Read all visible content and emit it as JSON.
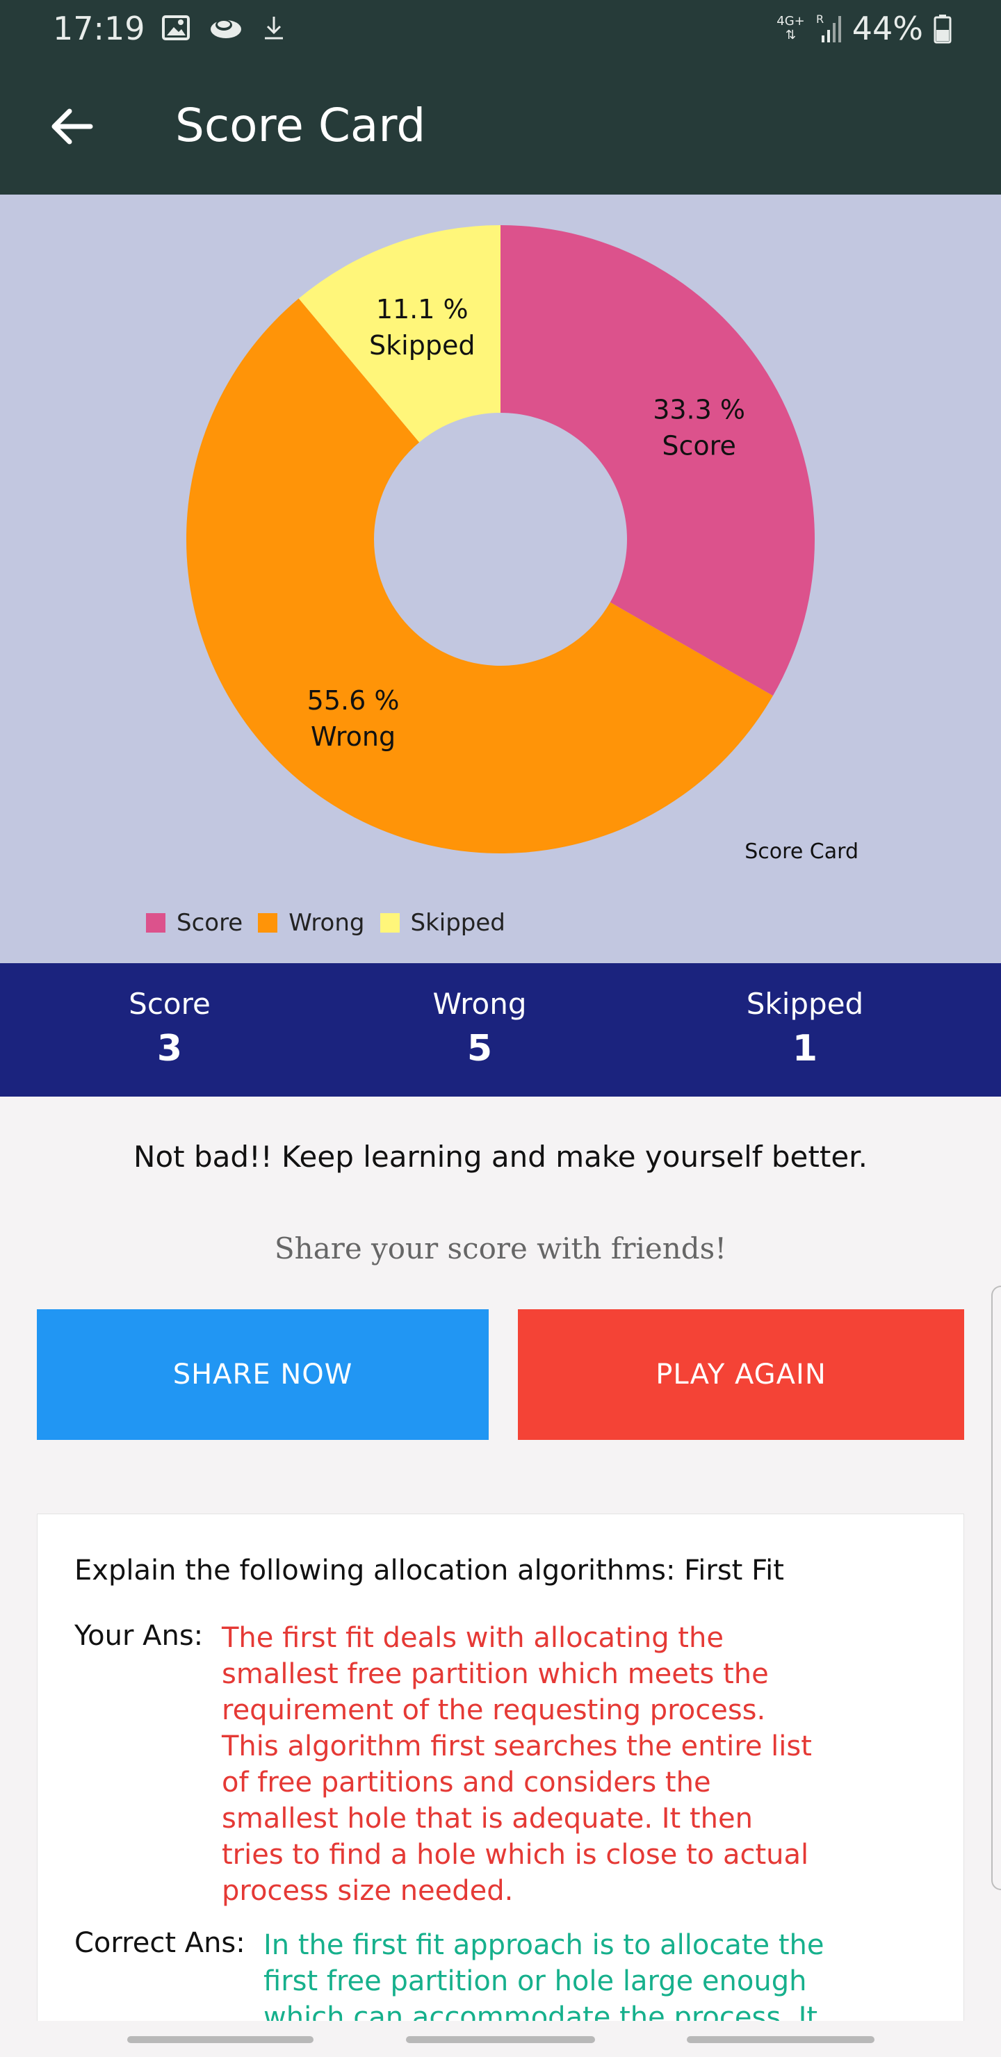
{
  "status_bar": {
    "time": "17:19",
    "network": "4G+",
    "roaming": "R",
    "battery": "44%",
    "icons": [
      "image-icon",
      "cloud-icon",
      "download-icon",
      "signal-icon",
      "battery-icon"
    ]
  },
  "app_bar": {
    "title": "Score Card",
    "back_icon": "arrow-left-icon"
  },
  "chart_data": {
    "type": "pie",
    "donut": true,
    "description": "Score Card",
    "slices": [
      {
        "label": "Score",
        "value": 33.3,
        "display": "33.3 %",
        "color": "#dc528c"
      },
      {
        "label": "Wrong",
        "value": 55.6,
        "display": "55.6 %",
        "color": "#ff9408"
      },
      {
        "label": "Skipped",
        "value": 11.1,
        "display": "11.1 %",
        "color": "#fff67a"
      }
    ],
    "legend": [
      "Score",
      "Wrong",
      "Skipped"
    ],
    "legend_position": "bottom-left"
  },
  "stats": [
    {
      "label": "Score",
      "value": "3"
    },
    {
      "label": "Wrong",
      "value": "5"
    },
    {
      "label": "Skipped",
      "value": "1"
    }
  ],
  "message": "Not bad!! Keep learning and make yourself better.",
  "share_prompt": "Share your score with friends!",
  "buttons": {
    "share": "SHARE NOW",
    "play_again": "PLAY AGAIN"
  },
  "answers": [
    {
      "question": "Explain the following allocation algorithms: First Fit",
      "your_ans_label": "Your Ans:",
      "your_ans": "The first fit deals with allocating the smallest free partition which meets the requirement of the requesting process. This algorithm first searches the entire list of free partitions and considers the smallest hole that is adequate. It then tries to find a hole which is close to actual process size needed.",
      "correct_ans_label": "Correct Ans:",
      "correct_ans": "In the first fit approach is to allocate the first free partition or hole large enough which can accommodate the process. It"
    }
  ],
  "colors": {
    "app_bar": "#263b39",
    "chart_bg": "#c2c7e0",
    "stats_bar": "#1b237e",
    "share_button": "#2196f3",
    "play_button": "#f44336",
    "wrong_answer_text": "#e53935",
    "correct_answer_text": "#16b08c"
  }
}
